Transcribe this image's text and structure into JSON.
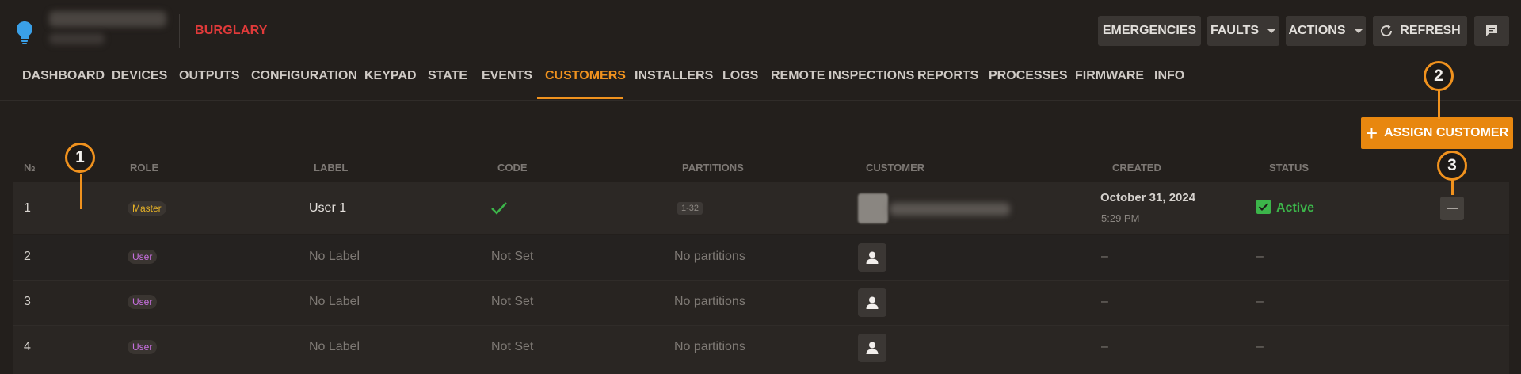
{
  "header": {
    "section": "BURGLARY",
    "buttons": {
      "emergencies": "EMERGENCIES",
      "faults": "FAULTS",
      "actions": "ACTIONS",
      "refresh": "REFRESH"
    }
  },
  "nav": {
    "items": [
      "DASHBOARD",
      "DEVICES",
      "OUTPUTS",
      "CONFIGURATION",
      "KEYPAD",
      "STATE",
      "EVENTS",
      "CUSTOMERS",
      "INSTALLERS",
      "LOGS",
      "REMOTE INSPECTIONS",
      "REPORTS",
      "PROCESSES",
      "FIRMWARE",
      "INFO"
    ],
    "active": "CUSTOMERS"
  },
  "assign_button": "ASSIGN CUSTOMER",
  "table": {
    "headers": [
      "№",
      "ROLE",
      "LABEL",
      "CODE",
      "PARTITIONS",
      "CUSTOMER",
      "CREATED",
      "STATUS"
    ],
    "rows": [
      {
        "num": "1",
        "role": "Master",
        "label": "User 1",
        "code": "check",
        "partitions": "1-32",
        "created_date": "October 31, 2024",
        "created_time": "5:29 PM",
        "status": "Active"
      },
      {
        "num": "2",
        "role": "User",
        "label": "No Label",
        "code": "Not Set",
        "partitions": "No partitions",
        "created": "–",
        "status": "–"
      },
      {
        "num": "3",
        "role": "User",
        "label": "No Label",
        "code": "Not Set",
        "partitions": "No partitions",
        "created": "–",
        "status": "–"
      },
      {
        "num": "4",
        "role": "User",
        "label": "No Label",
        "code": "Not Set",
        "partitions": "No partitions",
        "created": "–",
        "status": "–"
      }
    ]
  },
  "markers": [
    "1",
    "2",
    "3"
  ],
  "colors": {
    "accent": "#f0921e",
    "alert": "#e03a3a",
    "success": "#3cb54a",
    "master_badge": "#e8b326",
    "user_badge": "#c870e0"
  }
}
